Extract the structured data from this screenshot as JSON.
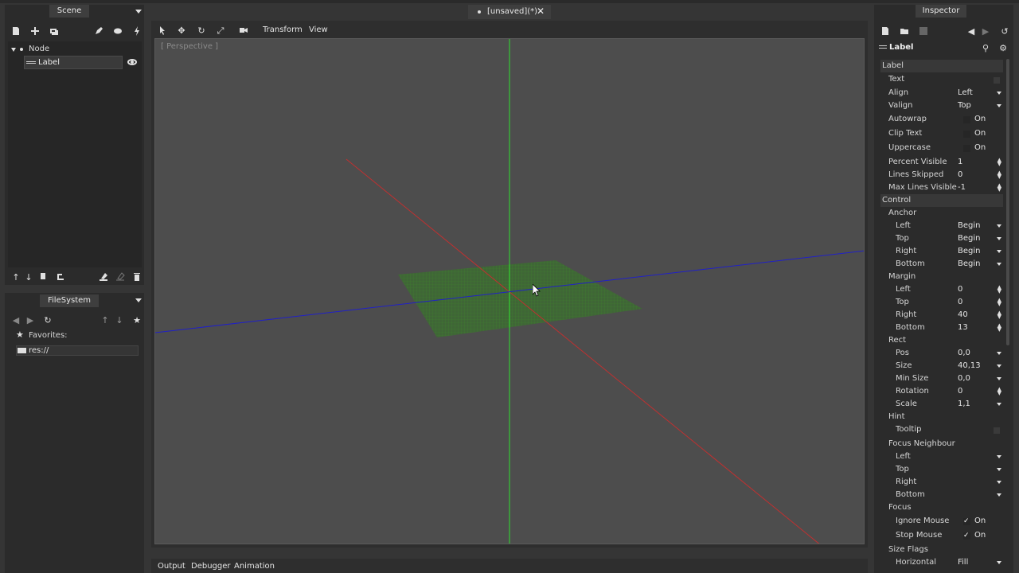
{
  "scene_panel": {
    "tab": "Scene",
    "tree": [
      {
        "label": "Node"
      },
      {
        "label": "Label"
      }
    ]
  },
  "filesystem_panel": {
    "tab": "FileSystem",
    "items": [
      {
        "label": "Favorites:"
      },
      {
        "label": "res://"
      }
    ]
  },
  "viewport": {
    "scene_tab": "[unsaved](*)",
    "menus": [
      "Transform",
      "View"
    ],
    "perspective_label": "[ Perspective ]"
  },
  "bottom_tabs": [
    "Output",
    "Debugger",
    "Animation"
  ],
  "inspector": {
    "tab": "Inspector",
    "object": "Label",
    "rows": [
      {
        "label": "Label",
        "value": "",
        "kind": "section"
      },
      {
        "label": "Text",
        "value": "",
        "kind": "text"
      },
      {
        "label": "Align",
        "value": "Left",
        "kind": "dropdown"
      },
      {
        "label": "Valign",
        "value": "Top",
        "kind": "dropdown"
      },
      {
        "label": "Autowrap",
        "value": "On",
        "kind": "check"
      },
      {
        "label": "Clip Text",
        "value": "On",
        "kind": "check"
      },
      {
        "label": "Uppercase",
        "value": "On",
        "kind": "check"
      },
      {
        "label": "Percent Visible",
        "value": "1",
        "kind": "spin"
      },
      {
        "label": "Lines Skipped",
        "value": "0",
        "kind": "spin"
      },
      {
        "label": "Max Lines Visible",
        "value": "-1",
        "kind": "spin"
      },
      {
        "label": "Control",
        "value": "",
        "kind": "section"
      },
      {
        "label": "Anchor",
        "value": "",
        "kind": "group"
      },
      {
        "label": "Left",
        "value": "Begin",
        "kind": "dropdown"
      },
      {
        "label": "Top",
        "value": "Begin",
        "kind": "dropdown"
      },
      {
        "label": "Right",
        "value": "Begin",
        "kind": "dropdown"
      },
      {
        "label": "Bottom",
        "value": "Begin",
        "kind": "dropdown"
      },
      {
        "label": "Margin",
        "value": "",
        "kind": "group"
      },
      {
        "label": "Left",
        "value": "0",
        "kind": "spin"
      },
      {
        "label": "Top",
        "value": "0",
        "kind": "spin"
      },
      {
        "label": "Right",
        "value": "40",
        "kind": "spin"
      },
      {
        "label": "Bottom",
        "value": "13",
        "kind": "spin"
      },
      {
        "label": "Rect",
        "value": "",
        "kind": "group"
      },
      {
        "label": "Pos",
        "value": "0,0",
        "kind": "dropdown"
      },
      {
        "label": "Size",
        "value": "40,13",
        "kind": "dropdown"
      },
      {
        "label": "Min Size",
        "value": "0,0",
        "kind": "dropdown"
      },
      {
        "label": "Rotation",
        "value": "0",
        "kind": "spin"
      },
      {
        "label": "Scale",
        "value": "1,1",
        "kind": "dropdown"
      },
      {
        "label": "Hint",
        "value": "",
        "kind": "group"
      },
      {
        "label": "Tooltip",
        "value": "",
        "kind": "text"
      },
      {
        "label": "Focus Neighbour",
        "value": "",
        "kind": "group"
      },
      {
        "label": "Left",
        "value": "",
        "kind": "dropdown"
      },
      {
        "label": "Top",
        "value": "",
        "kind": "dropdown"
      },
      {
        "label": "Right",
        "value": "",
        "kind": "dropdown"
      },
      {
        "label": "Bottom",
        "value": "",
        "kind": "dropdown"
      },
      {
        "label": "Focus",
        "value": "",
        "kind": "group"
      },
      {
        "label": "Ignore Mouse",
        "value": "On",
        "kind": "checked"
      },
      {
        "label": "Stop Mouse",
        "value": "On",
        "kind": "checked"
      },
      {
        "label": "Size Flags",
        "value": "",
        "kind": "group"
      },
      {
        "label": "Horizontal",
        "value": "Fill",
        "kind": "dropdown"
      }
    ]
  },
  "colors": {
    "x_axis": "#c03030",
    "y_axis": "#30e030",
    "z_axis": "#2020c8",
    "grid": "#3a7a2a"
  }
}
